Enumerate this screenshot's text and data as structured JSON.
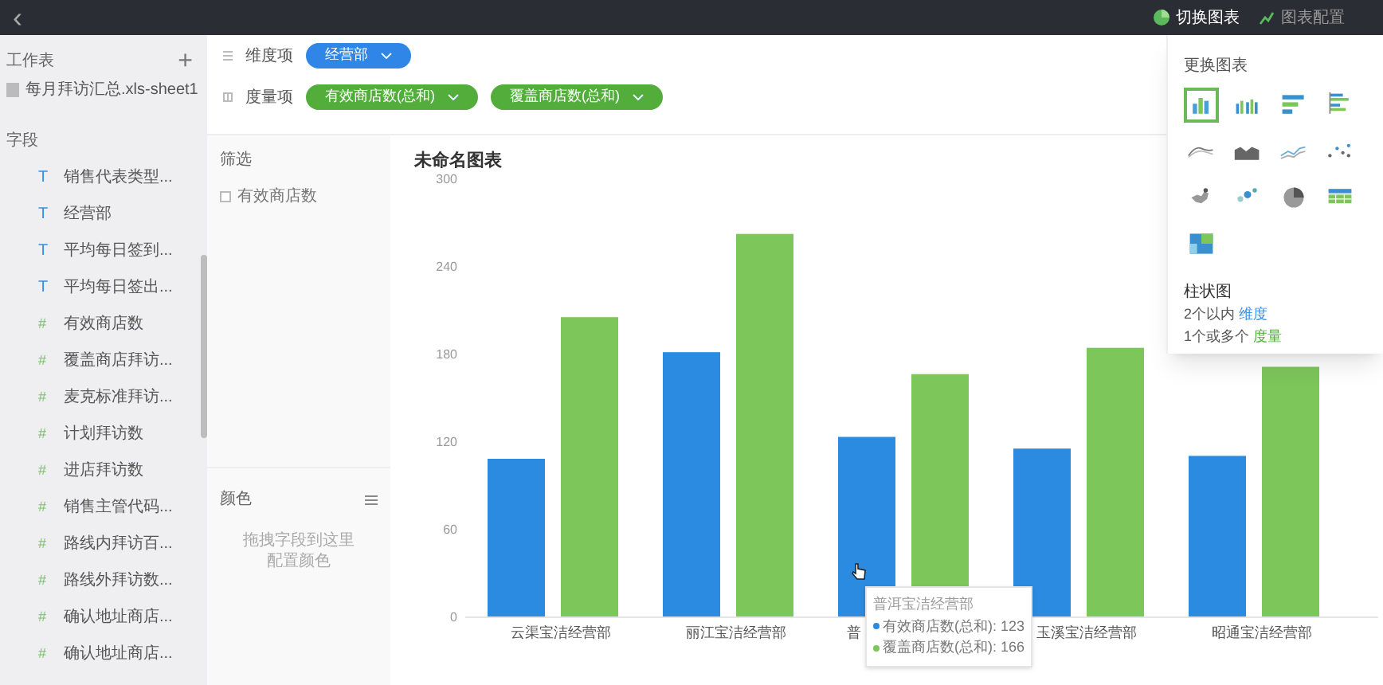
{
  "topbar": {
    "back": "‹",
    "actions": [
      {
        "label": "切换图表",
        "selected": true,
        "kind": "switch"
      },
      {
        "label": "图表配置",
        "selected": false,
        "kind": "config"
      }
    ]
  },
  "sidebar": {
    "worksheet_title": "工作表",
    "add": "+",
    "sheet": "每月拜访汇总.xls-sheet1",
    "fields_title": "字段",
    "fields": [
      {
        "label": "销售代表类型...",
        "kind": "text",
        "icon": "T"
      },
      {
        "label": "经营部",
        "kind": "text",
        "icon": "T"
      },
      {
        "label": "平均每日签到...",
        "kind": "text",
        "icon": "T"
      },
      {
        "label": "平均每日签出...",
        "kind": "text",
        "icon": "T"
      },
      {
        "label": "有效商店数",
        "kind": "number",
        "icon": "#"
      },
      {
        "label": "覆盖商店拜访...",
        "kind": "number",
        "icon": "#"
      },
      {
        "label": "麦克标准拜访...",
        "kind": "number",
        "icon": "#"
      },
      {
        "label": "计划拜访数",
        "kind": "number",
        "icon": "#"
      },
      {
        "label": "进店拜访数",
        "kind": "number",
        "icon": "#"
      },
      {
        "label": "销售主管代码...",
        "kind": "number",
        "icon": "#"
      },
      {
        "label": "路线内拜访百...",
        "kind": "number",
        "icon": "#"
      },
      {
        "label": "路线外拜访数...",
        "kind": "number",
        "icon": "#"
      },
      {
        "label": "确认地址商店...",
        "kind": "number",
        "icon": "#"
      },
      {
        "label": "确认地址商店...",
        "kind": "number",
        "icon": "#"
      }
    ]
  },
  "shelves": [
    {
      "label": "维度项",
      "kind": "dimension",
      "pills": [
        "经营部"
      ]
    },
    {
      "label": "度量项",
      "kind": "measure",
      "pills": [
        "有效商店数(总和)",
        "覆盖商店数(总和)"
      ]
    }
  ],
  "filter": {
    "title": "筛选",
    "items": [
      {
        "label": "有效商店数",
        "checked": false
      }
    ]
  },
  "color_panel": {
    "title": "颜色",
    "hint_lines": [
      "拖拽字段到这里",
      "配置颜色"
    ]
  },
  "chart": {
    "title": "未命名图表",
    "chart_data": {
      "type": "bar",
      "categories": [
        "云渠宝洁经营部",
        "丽江宝洁经营部",
        "普",
        "玉溪宝洁经营部",
        "昭通宝洁经营部"
      ],
      "series": [
        {
          "name": "有效商店数(总和)",
          "color": "#2b8be0",
          "values": [
            108,
            181,
            123,
            115,
            110
          ]
        },
        {
          "name": "覆盖商店数(总和)",
          "color": "#7cc65a",
          "values": [
            205,
            262,
            166,
            184,
            171
          ]
        }
      ],
      "ylim": [
        0,
        300
      ],
      "yticks": [
        0,
        60,
        120,
        180,
        240,
        300
      ]
    },
    "tooltip": {
      "title": "普洱宝洁经营部",
      "separator": ":",
      "values": [
        "123",
        "166"
      ]
    }
  },
  "chart_picker": {
    "title": "更换图表",
    "types": [
      {
        "kind": "bar",
        "selected": true
      },
      {
        "kind": "grouped-bar",
        "selected": false
      },
      {
        "kind": "hbar",
        "selected": false
      },
      {
        "kind": "hbar-grouped",
        "selected": false
      },
      {
        "kind": "line",
        "selected": false
      },
      {
        "kind": "area",
        "selected": false
      },
      {
        "kind": "line-points",
        "selected": false
      },
      {
        "kind": "scatter",
        "selected": false
      },
      {
        "kind": "map",
        "selected": false
      },
      {
        "kind": "bubble",
        "selected": false
      },
      {
        "kind": "pie",
        "selected": false
      },
      {
        "kind": "table",
        "selected": false
      },
      {
        "kind": "heatmap",
        "selected": false
      }
    ],
    "selected_name": "柱状图",
    "requirements": [
      {
        "prefix": "2个以内",
        "term": "维度",
        "kind": "dimension"
      },
      {
        "prefix": "1个或多个",
        "term": "度量",
        "kind": "measure"
      }
    ]
  }
}
